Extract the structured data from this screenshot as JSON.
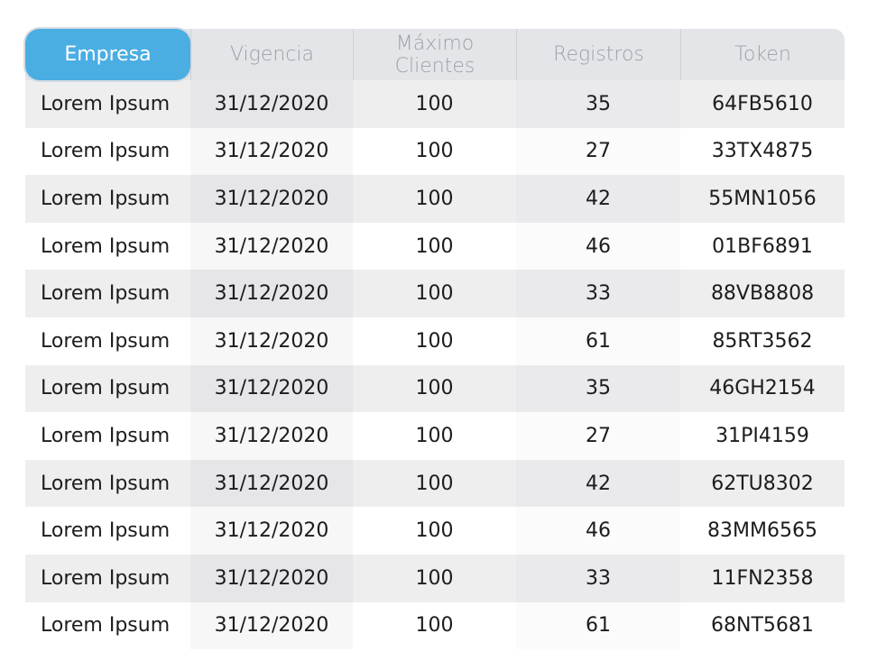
{
  "table": {
    "headers": [
      "Empresa",
      "Vigencia",
      "Máximo\nClientes",
      "Registros",
      "Token"
    ],
    "rows": [
      [
        "Lorem Ipsum",
        "31/12/2020",
        "100",
        "35",
        "64FB5610"
      ],
      [
        "Lorem Ipsum",
        "31/12/2020",
        "100",
        "27",
        "33TX4875"
      ],
      [
        "Lorem Ipsum",
        "31/12/2020",
        "100",
        "42",
        "55MN1056"
      ],
      [
        "Lorem Ipsum",
        "31/12/2020",
        "100",
        "46",
        "01BF6891"
      ],
      [
        "Lorem Ipsum",
        "31/12/2020",
        "100",
        "33",
        "88VB8808"
      ],
      [
        "Lorem Ipsum",
        "31/12/2020",
        "100",
        "61",
        "85RT3562"
      ],
      [
        "Lorem Ipsum",
        "31/12/2020",
        "100",
        "35",
        "46GH2154"
      ],
      [
        "Lorem Ipsum",
        "31/12/2020",
        "100",
        "27",
        "31PI4159"
      ],
      [
        "Lorem Ipsum",
        "31/12/2020",
        "100",
        "42",
        "62TU8302"
      ],
      [
        "Lorem Ipsum",
        "31/12/2020",
        "100",
        "46",
        "83MM6565"
      ],
      [
        "Lorem Ipsum",
        "31/12/2020",
        "100",
        "33",
        "11FN2358"
      ],
      [
        "Lorem Ipsum",
        "31/12/2020",
        "100",
        "61",
        "68NT5681"
      ]
    ]
  },
  "colors": {
    "active_header": "#4aaee3",
    "header_bg": "#e4e5e8",
    "header_text": "#9ea0a6",
    "cell_text": "#1c1c1e"
  }
}
